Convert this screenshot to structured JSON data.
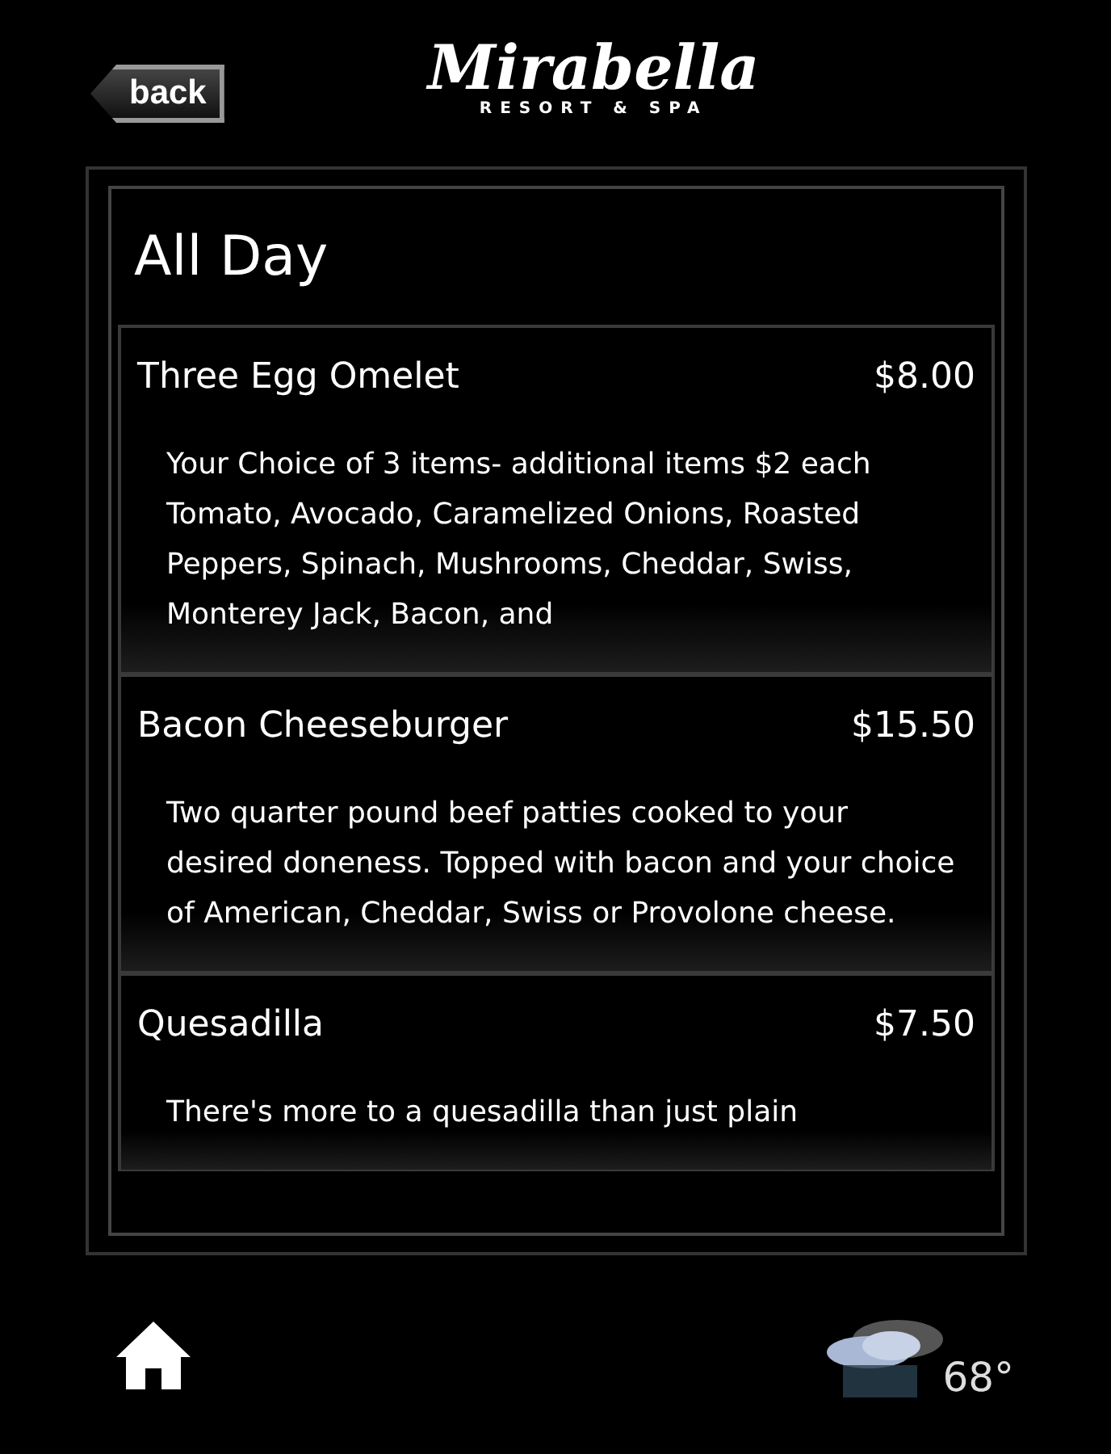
{
  "header": {
    "back_label": "back",
    "logo_name": "Mirabella",
    "logo_tagline": "RESORT & SPA"
  },
  "menu": {
    "title": "All Day",
    "items": [
      {
        "name": "Three Egg Omelet",
        "price": "$8.00",
        "description": "Your Choice of 3 items- additional items $2 each Tomato, Avocado, Caramelized Onions, Roasted Peppers, Spinach, Mushrooms, Cheddar, Swiss, Monterey Jack, Bacon, and"
      },
      {
        "name": "Bacon Cheeseburger",
        "price": "$15.50",
        "description": "Two quarter pound beef patties cooked to your desired doneness. Topped with bacon and your choice of American, Cheddar, Swiss or Provolone cheese."
      },
      {
        "name": "Quesadilla",
        "price": "$7.50",
        "description": "There's more to a quesadilla than just plain"
      }
    ]
  },
  "footer": {
    "temperature": "68°"
  }
}
